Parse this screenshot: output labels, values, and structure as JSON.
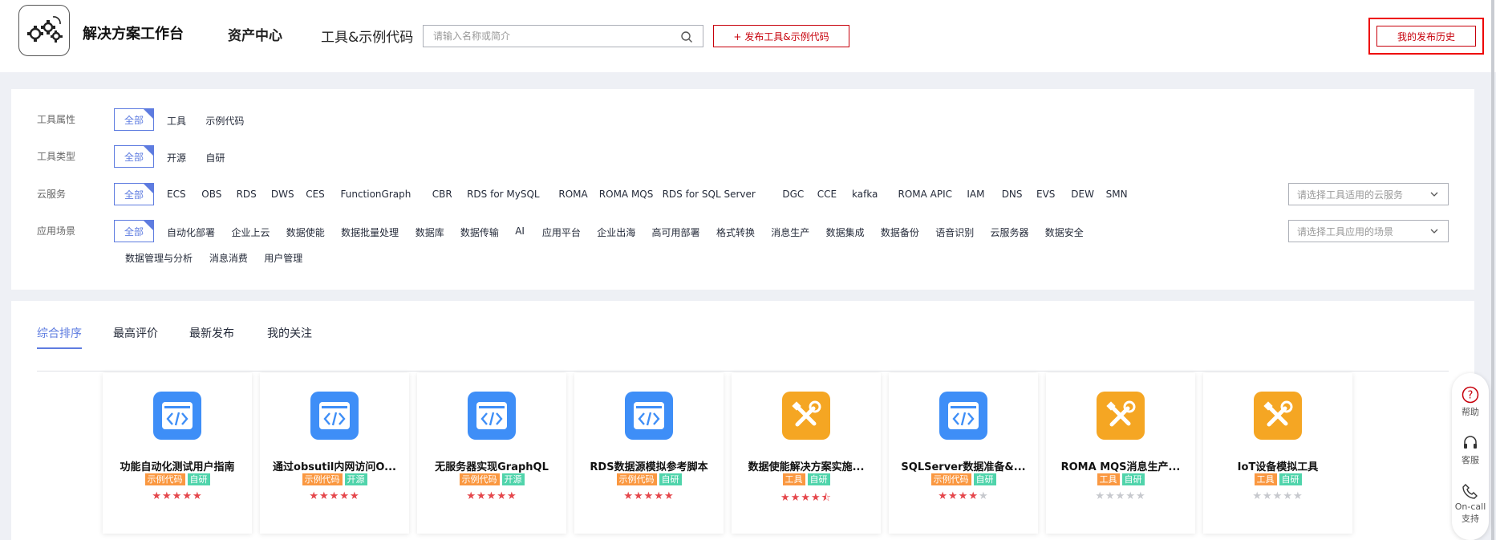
{
  "header": {
    "title": "解决方案工作台",
    "nav_asset": "资产中心",
    "nav_tools": "工具&示例代码",
    "search_placeholder": "请输入名称或简介",
    "publish_label": "+ 发布工具&示例代码",
    "history_label": "我的发布历史"
  },
  "filters": {
    "attr": {
      "label": "工具属性",
      "all": "全部",
      "options": [
        "工具",
        "示例代码"
      ]
    },
    "type": {
      "label": "工具类型",
      "all": "全部",
      "options": [
        "开源",
        "自研"
      ]
    },
    "cloud": {
      "label": "云服务",
      "all": "全部",
      "options": [
        "ECS",
        "OBS",
        "RDS",
        "DWS",
        "CES",
        "FunctionGraph",
        "CBR",
        "RDS for MySQL",
        "ROMA",
        "ROMA MQS",
        "RDS for SQL Server",
        "DGC",
        "CCE",
        "kafka",
        "ROMA APIC",
        "IAM",
        "DNS",
        "EVS",
        "DEW",
        "SMN"
      ],
      "select_placeholder": "请选择工具适用的云服务"
    },
    "scene": {
      "label": "应用场景",
      "all": "全部",
      "options": [
        "自动化部署",
        "企业上云",
        "数据使能",
        "数据批量处理",
        "数据库",
        "数据传输",
        "AI",
        "应用平台",
        "企业出海",
        "高可用部署",
        "格式转换",
        "消息生产",
        "数据集成",
        "数据备份",
        "语音识别",
        "云服务器",
        "数据安全"
      ],
      "options_row2": [
        "数据管理与分析",
        "消息消费",
        "用户管理"
      ],
      "select_placeholder": "请选择工具应用的场景"
    }
  },
  "tabs": [
    "综合排序",
    "最高评价",
    "最新发布",
    "我的关注"
  ],
  "active_tab": "综合排序",
  "cards": [
    {
      "title": "功能自动化测试用户指南",
      "icon": "code-icon",
      "tags": [
        "示例代码",
        "自研"
      ],
      "rating": 5
    },
    {
      "title": "通过obsutil内网访问O...",
      "icon": "code-icon",
      "tags": [
        "示例代码",
        "开源"
      ],
      "rating": 5
    },
    {
      "title": "无服务器实现GraphQL",
      "icon": "code-icon",
      "tags": [
        "示例代码",
        "开源"
      ],
      "rating": 5
    },
    {
      "title": "RDS数据源模拟参考脚本",
      "icon": "code-icon",
      "tags": [
        "示例代码",
        "自研"
      ],
      "rating": 5
    },
    {
      "title": "数据使能解决方案实施...",
      "icon": "tools-icon",
      "tags": [
        "工具",
        "自研"
      ],
      "rating": 4.5
    },
    {
      "title": "SQLServer数据准备&...",
      "icon": "code-icon",
      "tags": [
        "示例代码",
        "自研"
      ],
      "rating": 4
    },
    {
      "title": "ROMA MQS消息生产...",
      "icon": "tools-icon",
      "tags": [
        "工具",
        "自研"
      ],
      "rating": 0
    },
    {
      "title": "IoT设备模拟工具",
      "icon": "tools-icon",
      "tags": [
        "工具",
        "自研"
      ],
      "rating": 0
    }
  ],
  "float": {
    "help": "帮助",
    "service": "客服",
    "oncall_line1": "On-call",
    "oncall_line2": "支持"
  },
  "colors": {
    "accent": "#5e7ce0",
    "brand_red": "#c7000b",
    "code_icon": "#3e8ef7",
    "tool_icon": "#f5a623",
    "tag_orange": "#fa9841",
    "tag_green": "#50d4ab",
    "star": "#e5474c"
  }
}
